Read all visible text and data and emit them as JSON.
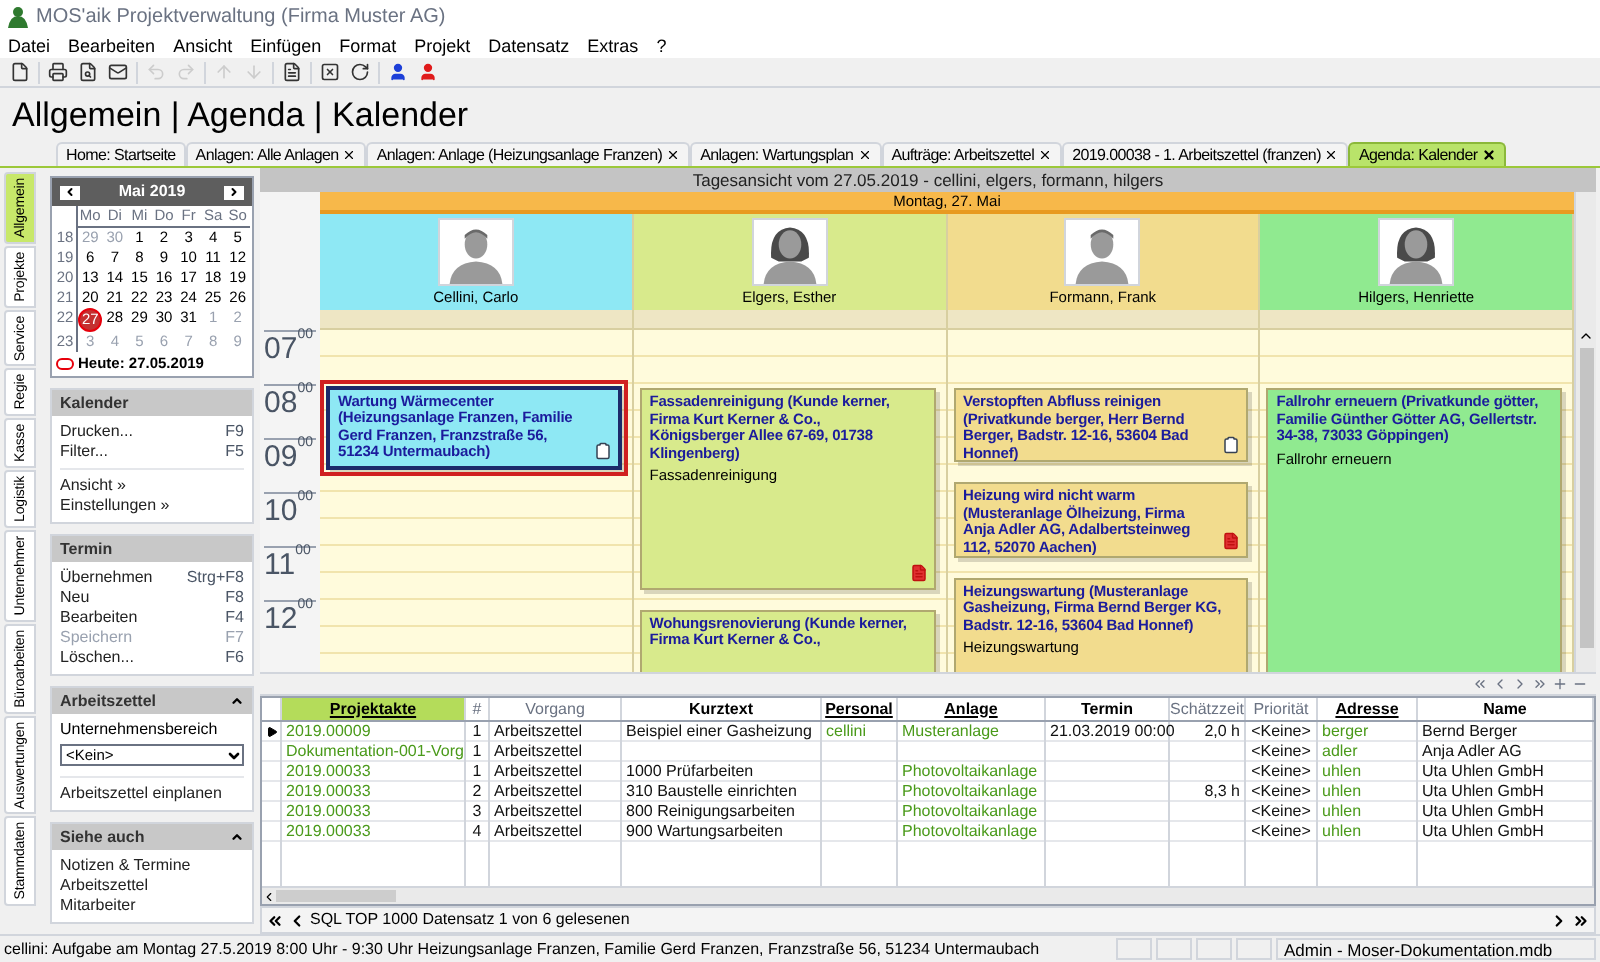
{
  "window": {
    "title": "MOS'aik Projektverwaltung (Firma Muster AG)"
  },
  "menu": [
    "Datei",
    "Bearbeiten",
    "Ansicht",
    "Einfügen",
    "Format",
    "Projekt",
    "Datensatz",
    "Extras",
    "?"
  ],
  "toolbar": [
    {
      "kind": "new",
      "disabled": false
    },
    {
      "kind": "separator"
    },
    {
      "kind": "print",
      "disabled": false
    },
    {
      "kind": "preview",
      "disabled": false
    },
    {
      "kind": "mail",
      "disabled": false
    },
    {
      "kind": "separator"
    },
    {
      "kind": "undo",
      "disabled": true
    },
    {
      "kind": "redo",
      "disabled": true
    },
    {
      "kind": "separator"
    },
    {
      "kind": "up",
      "disabled": true
    },
    {
      "kind": "down",
      "disabled": true
    },
    {
      "kind": "separator"
    },
    {
      "kind": "report",
      "disabled": false
    },
    {
      "kind": "separator"
    },
    {
      "kind": "cancel",
      "disabled": false
    },
    {
      "kind": "refresh",
      "disabled": false
    },
    {
      "kind": "separator"
    },
    {
      "kind": "user_in",
      "disabled": false
    },
    {
      "kind": "user_out",
      "disabled": false
    }
  ],
  "breadcrumb": "Allgemein | Agenda | Kalender",
  "doc_tabs": [
    {
      "label": "Home: Startseite",
      "closable": false,
      "selected": false
    },
    {
      "label": "Anlagen: Alle Anlagen",
      "closable": true,
      "selected": false
    },
    {
      "label": "Anlagen: Anlage (Heizungsanlage Franzen)",
      "closable": true,
      "selected": false
    },
    {
      "label": "Anlagen: Wartungsplan",
      "closable": true,
      "selected": false
    },
    {
      "label": "Aufträge: Arbeitszettel",
      "closable": true,
      "selected": false
    },
    {
      "label": "2019.00038 - 1. Arbeitszettel (franzen)",
      "closable": true,
      "selected": false
    },
    {
      "label": "Agenda: Kalender",
      "closable": true,
      "selected": true
    }
  ],
  "side_tabs": [
    {
      "label": "Allgemein",
      "selected": true
    },
    {
      "label": "Projekte",
      "selected": false
    },
    {
      "label": "Service",
      "selected": false
    },
    {
      "label": "Regie",
      "selected": false
    },
    {
      "label": "Kasse",
      "selected": false
    },
    {
      "label": "Logistik",
      "selected": false
    },
    {
      "label": "Unternehmer",
      "selected": false
    },
    {
      "label": "Büroarbeiten",
      "selected": false
    },
    {
      "label": "Auswertungen",
      "selected": false
    },
    {
      "label": "Stammdaten",
      "selected": false
    }
  ],
  "mini_calendar": {
    "month": "Mai 2019",
    "weekdays": [
      "Mo",
      "Di",
      "Mi",
      "Do",
      "Fr",
      "Sa",
      "So"
    ],
    "weeks": [
      {
        "week": "18",
        "days": [
          {
            "day": "29",
            "other_month": true,
            "today": false
          },
          {
            "day": "30",
            "other_month": true,
            "today": false
          },
          {
            "day": "1",
            "other_month": false,
            "today": false
          },
          {
            "day": "2",
            "other_month": false,
            "today": false
          },
          {
            "day": "3",
            "other_month": false,
            "today": false
          },
          {
            "day": "4",
            "other_month": false,
            "today": false
          },
          {
            "day": "5",
            "other_month": false,
            "today": false
          }
        ]
      },
      {
        "week": "19",
        "days": [
          {
            "day": "6",
            "other_month": false,
            "today": false
          },
          {
            "day": "7",
            "other_month": false,
            "today": false
          },
          {
            "day": "8",
            "other_month": false,
            "today": false
          },
          {
            "day": "9",
            "other_month": false,
            "today": false
          },
          {
            "day": "10",
            "other_month": false,
            "today": false
          },
          {
            "day": "11",
            "other_month": false,
            "today": false
          },
          {
            "day": "12",
            "other_month": false,
            "today": false
          }
        ]
      },
      {
        "week": "20",
        "days": [
          {
            "day": "13",
            "other_month": false,
            "today": false
          },
          {
            "day": "14",
            "other_month": false,
            "today": false
          },
          {
            "day": "15",
            "other_month": false,
            "today": false
          },
          {
            "day": "16",
            "other_month": false,
            "today": false
          },
          {
            "day": "17",
            "other_month": false,
            "today": false
          },
          {
            "day": "18",
            "other_month": false,
            "today": false
          },
          {
            "day": "19",
            "other_month": false,
            "today": false
          }
        ]
      },
      {
        "week": "21",
        "days": [
          {
            "day": "20",
            "other_month": false,
            "today": false
          },
          {
            "day": "21",
            "other_month": false,
            "today": false
          },
          {
            "day": "22",
            "other_month": false,
            "today": false
          },
          {
            "day": "23",
            "other_month": false,
            "today": false
          },
          {
            "day": "24",
            "other_month": false,
            "today": false
          },
          {
            "day": "25",
            "other_month": false,
            "today": false
          },
          {
            "day": "26",
            "other_month": false,
            "today": false
          }
        ]
      },
      {
        "week": "22",
        "days": [
          {
            "day": "27",
            "other_month": false,
            "today": true
          },
          {
            "day": "28",
            "other_month": false,
            "today": false
          },
          {
            "day": "29",
            "other_month": false,
            "today": false
          },
          {
            "day": "30",
            "other_month": false,
            "today": false
          },
          {
            "day": "31",
            "other_month": false,
            "today": false
          },
          {
            "day": "1",
            "other_month": true,
            "today": false
          },
          {
            "day": "2",
            "other_month": true,
            "today": false
          }
        ]
      },
      {
        "week": "23",
        "days": [
          {
            "day": "3",
            "other_month": true,
            "today": false
          },
          {
            "day": "4",
            "other_month": true,
            "today": false
          },
          {
            "day": "5",
            "other_month": true,
            "today": false
          },
          {
            "day": "6",
            "other_month": true,
            "today": false
          },
          {
            "day": "7",
            "other_month": true,
            "today": false
          },
          {
            "day": "8",
            "other_month": true,
            "today": false
          },
          {
            "day": "9",
            "other_month": true,
            "today": false
          }
        ]
      }
    ],
    "today_label": "Heute: 27.05.2019"
  },
  "panels": [
    {
      "title": "Kalender",
      "collapsible": false,
      "items": [
        {
          "kind": "command",
          "label": "Drucken...",
          "shortcut": "F9",
          "disabled": false
        },
        {
          "kind": "command",
          "label": "Filter...",
          "shortcut": "F5",
          "disabled": false
        },
        {
          "kind": "divider"
        },
        {
          "kind": "command",
          "label": "Ansicht »",
          "disabled": false
        },
        {
          "kind": "command",
          "label": "Einstellungen »",
          "disabled": false
        }
      ]
    },
    {
      "title": "Termin",
      "collapsible": false,
      "items": [
        {
          "kind": "command",
          "label": "Übernehmen",
          "shortcut": "Strg+F8",
          "disabled": false
        },
        {
          "kind": "command",
          "label": "Neu",
          "shortcut": "F8",
          "disabled": false
        },
        {
          "kind": "command",
          "label": "Bearbeiten",
          "shortcut": "F4",
          "disabled": false
        },
        {
          "kind": "command",
          "label": "Speichern",
          "shortcut": "F7",
          "disabled": true
        },
        {
          "kind": "command",
          "label": "Löschen...",
          "shortcut": "F6",
          "disabled": false
        }
      ]
    },
    {
      "title": "Arbeitszettel",
      "collapsible": true,
      "items": [
        {
          "kind": "label",
          "label": "Unternehmensbereich"
        },
        {
          "kind": "select",
          "value": "<Kein>"
        },
        {
          "kind": "divider"
        },
        {
          "kind": "command",
          "label": "Arbeitszettel einplanen",
          "disabled": false
        }
      ]
    },
    {
      "title": "Siehe auch",
      "collapsible": true,
      "items": [
        {
          "kind": "command",
          "label": "Notizen & Termine",
          "disabled": false
        },
        {
          "kind": "command",
          "label": "Arbeitszettel",
          "disabled": false
        },
        {
          "kind": "command",
          "label": "Mitarbeiter",
          "disabled": false
        }
      ]
    }
  ],
  "calendar": {
    "title": "Tagesansicht vom 27.05.2019 - cellini, elgers, formann, hilgers",
    "day": "Montag, 27. Mai",
    "hours": [
      "07$^{00}$",
      "08$^{00}$",
      "09$^{00}$",
      "10$^{00}$",
      "11$^{00}$",
      "12$^{00}$"
    ],
    "resources": [
      {
        "name": "Cellini, Carlo",
        "avatar": {
          "kind": "male"
        },
        "color": "#8ee8f4",
        "events": [
          {
            "title": "Wartung Wärmecenter (Heizungsanlage Franzen, Familie Gerd Franzen, Franzstraße 56, 51234 Untermaubach)",
            "marker": {
              "kind": "doc"
            },
            "selected": true
          }
        ]
      },
      {
        "name": "Elgers, Esther",
        "avatar": {
          "kind": "female"
        },
        "color": "#d8ea8c",
        "events": [
          {
            "title": "Fassadenreinigung (Kunde kerner, Firma Kurt Kerner & Co., Königsberger Allee 67-69, 01738 Klingenberg)",
            "note": "Fassadenreinigung",
            "marker": {
              "kind": "alert"
            },
            "selected": false
          },
          {
            "title": "Wohungsrenovierung (Kunde kerner, Firma Kurt Kerner & Co.,",
            "selected": false
          }
        ]
      },
      {
        "name": "Formann, Frank",
        "avatar": {
          "kind": "male"
        },
        "color": "#f2dc8e",
        "events": [
          {
            "title": "Verstopften Abfluss reinigen (Privatkunde berger, Herr Bernd Berger, Badstr. 12-16, 53604 Bad Honnef)",
            "marker": {
              "kind": "doc"
            },
            "selected": false
          },
          {
            "title": "Heizung wird nicht warm (Musteranlage Ölheizung, Firma Anja Adler AG, Adalbertsteinweg 112, 52070 Aachen)",
            "marker": {
              "kind": "alert"
            },
            "selected": false
          },
          {
            "title": "Heizungswartung (Musteranlage Gasheizung, Firma Bernd Berger KG, Badstr. 12-16, 53604 Bad Honnef)",
            "note": "Heizungswartung",
            "selected": false
          }
        ]
      },
      {
        "name": "Hilgers, Henriette",
        "avatar": {
          "kind": "female"
        },
        "color": "#90ea90",
        "events": [
          {
            "title": "Fallrohr erneuern (Privatkunde götter, Familie Günther Götter AG, Gellertstr. 34-38, 73033 Göppingen)",
            "note": "Fallrohr erneuern",
            "selected": false
          }
        ]
      }
    ]
  },
  "table": {
    "columns": [
      {
        "label": "Projektakte",
        "kind": "link",
        "sorted": true
      },
      {
        "label": "#",
        "kind": "muted",
        "sorted": false
      },
      {
        "label": "Vorgang",
        "kind": "muted",
        "sorted": false
      },
      {
        "label": "Kurztext",
        "kind": "bold",
        "sorted": false
      },
      {
        "label": "Personal",
        "kind": "link",
        "sorted": false
      },
      {
        "label": "Anlage",
        "kind": "link",
        "sorted": false
      },
      {
        "label": "Termin",
        "kind": "bold",
        "sorted": false
      },
      {
        "label": "Schätzzeit",
        "kind": "muted",
        "sorted": false
      },
      {
        "label": "Priorität",
        "kind": "muted",
        "sorted": false
      },
      {
        "label": "Adresse",
        "kind": "link",
        "sorted": false
      },
      {
        "label": "Name",
        "kind": "bold",
        "sorted": false
      }
    ],
    "rows": [
      {
        "selected": true,
        "cells": [
          "2019.00009",
          "1",
          "Arbeitszettel",
          "Beispiel einer Gasheizung",
          "cellini",
          "Musteranlage",
          "21.03.2019 00:00",
          "2,0 h",
          "<Keine>",
          "berger",
          "Bernd Berger"
        ]
      },
      {
        "selected": false,
        "cells": [
          "Dokumentation-001-Vorg",
          "1",
          "Arbeitszettel",
          null,
          null,
          null,
          null,
          null,
          "<Keine>",
          "adler",
          "Anja Adler AG"
        ]
      },
      {
        "selected": false,
        "cells": [
          "2019.00033",
          "1",
          "Arbeitszettel",
          "1000 Prüfarbeiten",
          null,
          "Photovoltaikanlage",
          null,
          null,
          "<Keine>",
          "uhlen",
          "Uta Uhlen GmbH"
        ]
      },
      {
        "selected": false,
        "cells": [
          "2019.00033",
          "2",
          "Arbeitszettel",
          "310 Baustelle einrichten",
          null,
          "Photovoltaikanlage",
          null,
          "8,3 h",
          "<Keine>",
          "uhlen",
          "Uta Uhlen GmbH"
        ]
      },
      {
        "selected": false,
        "cells": [
          "2019.00033",
          "3",
          "Arbeitszettel",
          "800 Reinigungsarbeiten",
          null,
          "Photovoltaikanlage",
          null,
          null,
          "<Keine>",
          "uhlen",
          "Uta Uhlen GmbH"
        ]
      },
      {
        "selected": false,
        "cells": [
          "2019.00033",
          "4",
          "Arbeitszettel",
          "900 Wartungsarbeiten",
          null,
          "Photovoltaikanlage",
          null,
          null,
          "<Keine>",
          "uhlen",
          "Uta Uhlen GmbH"
        ]
      }
    ],
    "record_info": "SQL TOP 1000 Datensatz 1 von 6 gelesenen"
  },
  "status_bar": {
    "message": "cellini: Aufgabe am Montag 27.5.2019 8:00 Uhr - 9:30 Uhr Heizungsanlage Franzen, Familie Gerd Franzen, Franzstraße 56, 51234 Untermaubach",
    "database": "Admin - Moser-Dokumentation.mdb"
  }
}
